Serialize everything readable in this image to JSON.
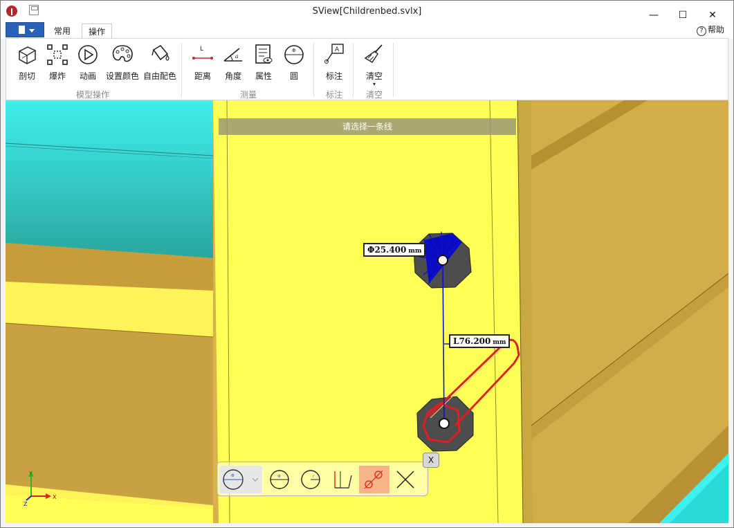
{
  "window": {
    "title": "SView[Childrenbed.svlx]",
    "minimize_glyph": "—",
    "maximize_glyph": "☐",
    "close_glyph": "✕",
    "help_label": "帮助"
  },
  "tabs": [
    {
      "label": "常用",
      "active": false
    },
    {
      "label": "操作",
      "active": true
    }
  ],
  "ribbon": {
    "groups": [
      {
        "label": "模型操作",
        "buttons": [
          "剖切",
          "爆炸",
          "动画",
          "设置颜色",
          "自由配色"
        ]
      },
      {
        "label": "测量",
        "buttons": [
          "距离",
          "角度",
          "属性",
          "圆"
        ]
      },
      {
        "label": "标注",
        "buttons": [
          "标注"
        ]
      },
      {
        "label": "清空",
        "buttons": [
          "清空"
        ]
      }
    ]
  },
  "viewport": {
    "hint": "请选择一条线",
    "diameter_label": {
      "value": "Φ25.400",
      "unit": "mm"
    },
    "length_label": {
      "value": "L76.200",
      "unit": "mm"
    },
    "axis_labels": {
      "y": "Y",
      "x": "X",
      "z": "Z"
    }
  },
  "measure_toolbar": {
    "close_label": "X",
    "tools": [
      "diameter-icon",
      "circle-diameter-icon",
      "circle-radius-icon",
      "line-distance-icon",
      "center-distance-icon",
      "cross-icon"
    ],
    "active_tool": "center-distance-icon"
  },
  "colors": {
    "accent": "#2a62b8",
    "model_yellow": "#ffff55",
    "model_gold": "#d9b04a",
    "model_cyan": "#35e6e6",
    "highlight_red": "#e02020",
    "measure_blue": "#1010d0"
  }
}
